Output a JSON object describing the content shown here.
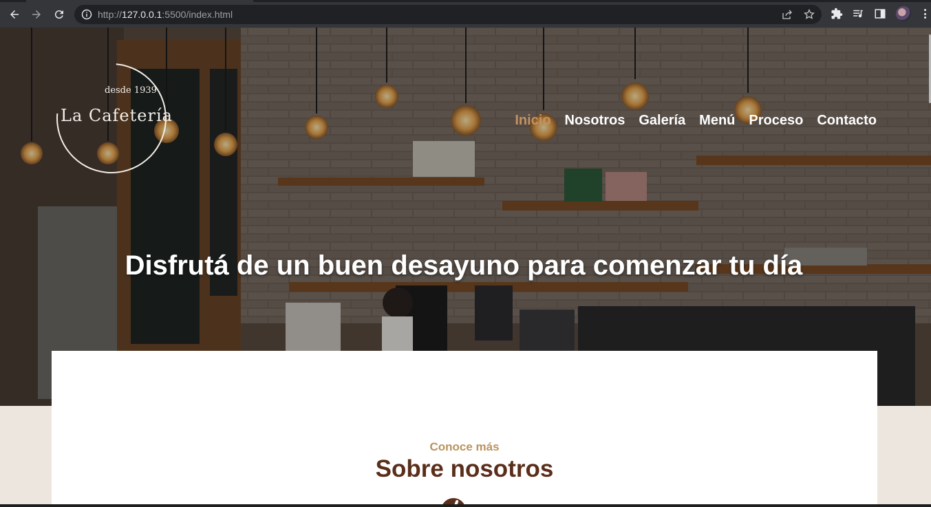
{
  "browser": {
    "url_prefix": "http://",
    "url_host": "127.0.0.1",
    "url_rest": ":5500/index.html",
    "icons": {
      "back": "back-arrow-icon",
      "forward": "forward-arrow-icon",
      "reload": "reload-icon",
      "info": "info-icon",
      "share": "share-icon",
      "bookmark": "star-icon",
      "extensions": "puzzle-icon",
      "media": "media-queue-icon",
      "sidepanel": "side-panel-icon",
      "menu": "kebab-menu-icon"
    }
  },
  "site": {
    "logo": {
      "since": "desde 1939",
      "brand": "La Cafetería"
    },
    "nav": [
      {
        "label": "Inicio",
        "active": true
      },
      {
        "label": "Nosotros",
        "active": false
      },
      {
        "label": "Galería",
        "active": false
      },
      {
        "label": "Menú",
        "active": false
      },
      {
        "label": "Proceso",
        "active": false
      },
      {
        "label": "Contacto",
        "active": false
      }
    ],
    "hero_headline": "Disfrutá de un buen desayuno para comenzar tu día",
    "about": {
      "eyebrow": "Conoce más",
      "title": "Sobre nosotros"
    }
  },
  "colors": {
    "accent": "#c6925e",
    "brown": "#5a2e1a",
    "eyebrow": "#b9935d",
    "section_bg": "#ece6df"
  }
}
